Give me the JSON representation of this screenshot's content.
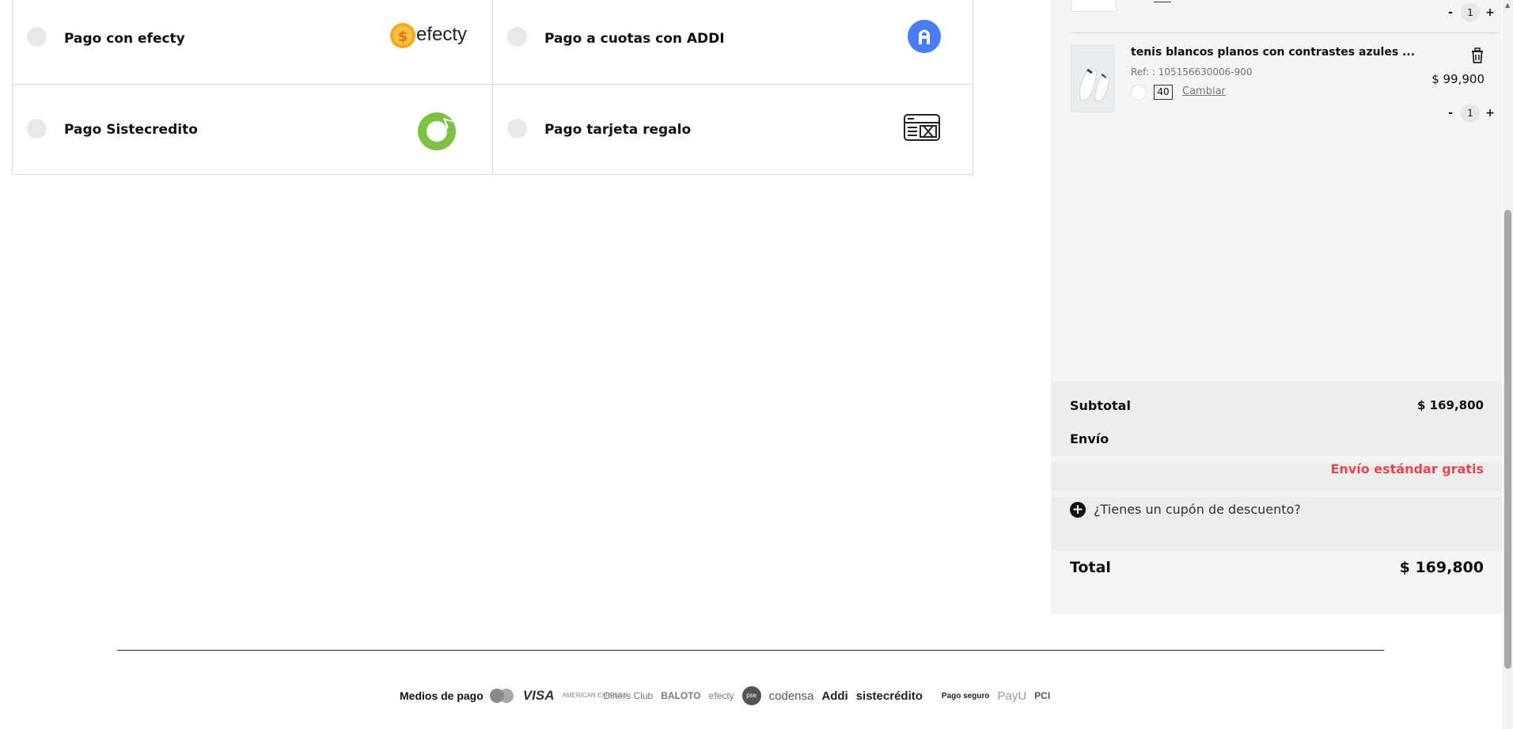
{
  "payment_options": [
    {
      "label": "Pago con efecty",
      "logo_text": "efecty",
      "logo": "efecty-logo"
    },
    {
      "label": "Pago a cuotas con ADDI",
      "logo": "addi-logo",
      "logo_color": "#4a7cf6"
    },
    {
      "label": "Pago Sistecredito",
      "logo": "sistecredito-logo",
      "logo_color": "#7cc242"
    },
    {
      "label": "Pago tarjeta regalo",
      "logo": "gift-card-icon"
    }
  ],
  "cart": {
    "prev_item": {
      "qty": "1",
      "minus": "-",
      "plus": "+"
    },
    "item": {
      "name": "tenis blancos planos con contrastes azules ...",
      "ref": "Ref: : 105156630006-900",
      "size": "40",
      "change_label": "Cambiar",
      "price": "$ 99,900",
      "qty": "1",
      "minus": "-",
      "plus": "+"
    }
  },
  "summary": {
    "subtotal_label": "Subtotal",
    "subtotal_value": "$ 169,800",
    "shipping_label": "Envío",
    "shipping_value": "Envío estándar gratis",
    "coupon_label": "¿Tienes un cupón de descuento?",
    "total_label": "Total",
    "total_value": "$ 169,800"
  },
  "footer": {
    "methods_title": "Medios de pago",
    "methods": [
      "MasterCard",
      "VISA",
      "AMERICAN EXPRESS",
      "Diners Club",
      "BALOTO",
      "efecty",
      "pse",
      "codensa",
      "Addi",
      "sistecrédito"
    ],
    "secure_label": "Pago seguro",
    "secure_providers": [
      "PayU",
      "PCI"
    ]
  },
  "colors": {
    "accent_red": "#e4464d",
    "sidebar_bg": "#f4f4f4",
    "summary_bg": "#ececec"
  }
}
